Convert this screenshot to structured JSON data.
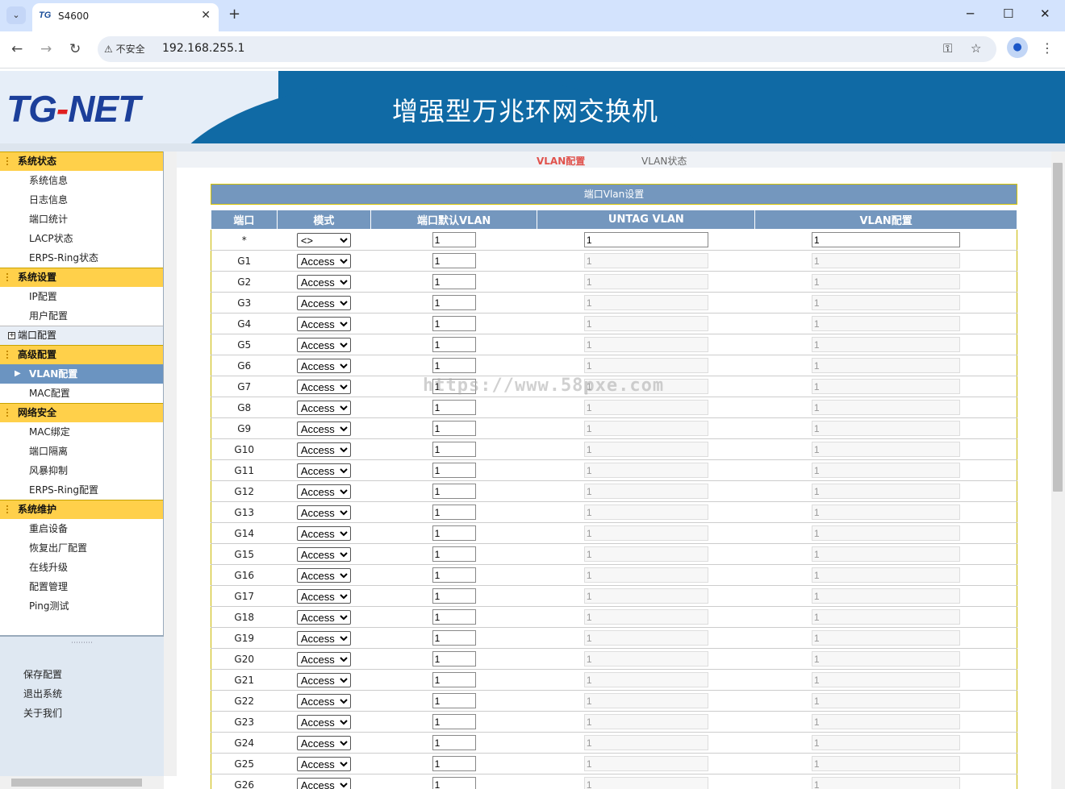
{
  "browser": {
    "tab_title": "S4600",
    "tab_logo": "TG",
    "security_label": "不安全",
    "url": "192.168.255.1"
  },
  "header": {
    "brand_tg": "TG",
    "brand_dash": "-",
    "brand_net": "NET",
    "title": "增强型万兆环网交换机"
  },
  "sidebar": {
    "groups": [
      {
        "label": "系统状态",
        "items": [
          "系统信息",
          "日志信息",
          "端口统计",
          "LACP状态",
          "ERPS-Ring状态"
        ]
      },
      {
        "label": "系统设置",
        "items": [
          "IP配置",
          "用户配置"
        ]
      },
      {
        "label": "端口配置",
        "items": []
      },
      {
        "label": "高级配置",
        "items": [
          "VLAN配置",
          "MAC配置"
        ]
      },
      {
        "label": "网络安全",
        "items": [
          "MAC绑定",
          "端口隔离",
          "风暴抑制",
          "ERPS-Ring配置"
        ]
      },
      {
        "label": "系统维护",
        "items": [
          "重启设备",
          "恢复出厂配置",
          "在线升级",
          "配置管理",
          "Ping测试"
        ]
      }
    ],
    "footer": [
      "保存配置",
      "退出系统",
      "关于我们"
    ]
  },
  "content": {
    "tab_active": "VLAN配置",
    "tab_other": "VLAN状态",
    "table_title": "端口Vlan设置",
    "columns": [
      "端口",
      "模式",
      "端口默认VLAN",
      "UNTAG VLAN",
      "VLAN配置"
    ],
    "all_row": {
      "port": "*",
      "mode": "<>",
      "pvid": "1",
      "untag": "1",
      "vlan": "1"
    },
    "rows": [
      {
        "port": "G1",
        "mode": "Access",
        "pvid": "1",
        "untag": "1",
        "vlan": "1"
      },
      {
        "port": "G2",
        "mode": "Access",
        "pvid": "1",
        "untag": "1",
        "vlan": "1"
      },
      {
        "port": "G3",
        "mode": "Access",
        "pvid": "1",
        "untag": "1",
        "vlan": "1"
      },
      {
        "port": "G4",
        "mode": "Access",
        "pvid": "1",
        "untag": "1",
        "vlan": "1"
      },
      {
        "port": "G5",
        "mode": "Access",
        "pvid": "1",
        "untag": "1",
        "vlan": "1"
      },
      {
        "port": "G6",
        "mode": "Access",
        "pvid": "1",
        "untag": "1",
        "vlan": "1"
      },
      {
        "port": "G7",
        "mode": "Access",
        "pvid": "1",
        "untag": "1",
        "vlan": "1"
      },
      {
        "port": "G8",
        "mode": "Access",
        "pvid": "1",
        "untag": "1",
        "vlan": "1"
      },
      {
        "port": "G9",
        "mode": "Access",
        "pvid": "1",
        "untag": "1",
        "vlan": "1"
      },
      {
        "port": "G10",
        "mode": "Access",
        "pvid": "1",
        "untag": "1",
        "vlan": "1"
      },
      {
        "port": "G11",
        "mode": "Access",
        "pvid": "1",
        "untag": "1",
        "vlan": "1"
      },
      {
        "port": "G12",
        "mode": "Access",
        "pvid": "1",
        "untag": "1",
        "vlan": "1"
      },
      {
        "port": "G13",
        "mode": "Access",
        "pvid": "1",
        "untag": "1",
        "vlan": "1"
      },
      {
        "port": "G14",
        "mode": "Access",
        "pvid": "1",
        "untag": "1",
        "vlan": "1"
      },
      {
        "port": "G15",
        "mode": "Access",
        "pvid": "1",
        "untag": "1",
        "vlan": "1"
      },
      {
        "port": "G16",
        "mode": "Access",
        "pvid": "1",
        "untag": "1",
        "vlan": "1"
      },
      {
        "port": "G17",
        "mode": "Access",
        "pvid": "1",
        "untag": "1",
        "vlan": "1"
      },
      {
        "port": "G18",
        "mode": "Access",
        "pvid": "1",
        "untag": "1",
        "vlan": "1"
      },
      {
        "port": "G19",
        "mode": "Access",
        "pvid": "1",
        "untag": "1",
        "vlan": "1"
      },
      {
        "port": "G20",
        "mode": "Access",
        "pvid": "1",
        "untag": "1",
        "vlan": "1"
      },
      {
        "port": "G21",
        "mode": "Access",
        "pvid": "1",
        "untag": "1",
        "vlan": "1"
      },
      {
        "port": "G22",
        "mode": "Access",
        "pvid": "1",
        "untag": "1",
        "vlan": "1"
      },
      {
        "port": "G23",
        "mode": "Access",
        "pvid": "1",
        "untag": "1",
        "vlan": "1"
      },
      {
        "port": "G24",
        "mode": "Access",
        "pvid": "1",
        "untag": "1",
        "vlan": "1"
      },
      {
        "port": "G25",
        "mode": "Access",
        "pvid": "1",
        "untag": "1",
        "vlan": "1"
      },
      {
        "port": "G26",
        "mode": "Access",
        "pvid": "1",
        "untag": "1",
        "vlan": "1"
      }
    ]
  },
  "watermark": "https://www.58pxe.com",
  "colors": {
    "header_blue": "#106aa5",
    "group_yellow": "#ffd04a",
    "table_header": "#7497be",
    "active_tab": "#e0524c"
  }
}
